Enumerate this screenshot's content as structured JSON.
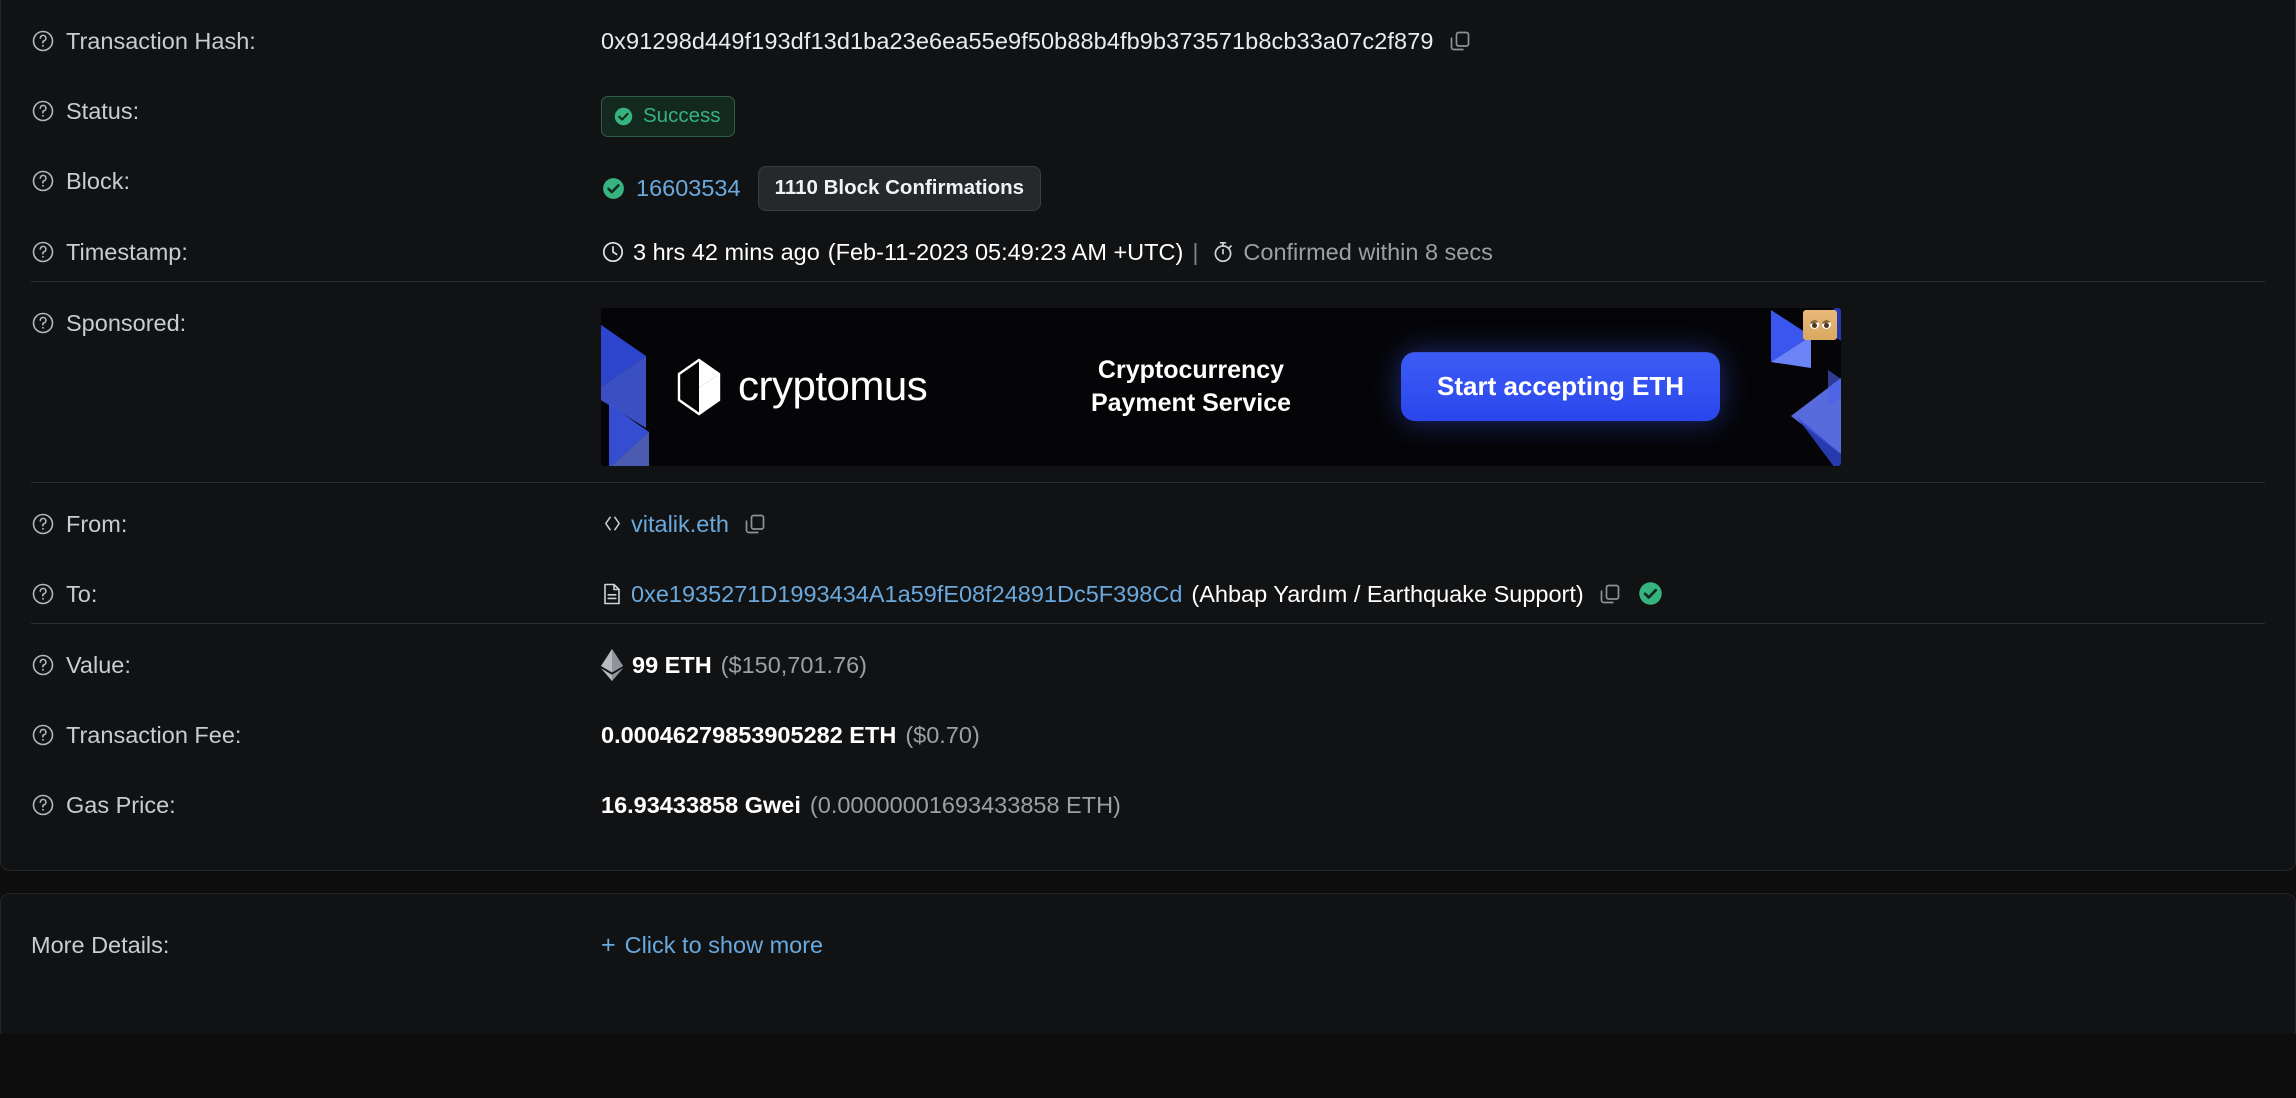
{
  "theme": {
    "page_bg": "#0d0d0d",
    "card_bg": "#111213",
    "divider": "#2a2c2f",
    "link_blue": "#6aa9dd",
    "success_green": "#36b37e",
    "text_primary": "#e9ecef",
    "text_muted": "#9aa0a6",
    "banner_cta_blue": "#3a58f5"
  },
  "rows": {
    "transaction_hash": {
      "label": "Transaction Hash:",
      "help_icon": "help-circle-icon",
      "value": "0x91298d449f193df13d1ba23e6ea55e9f50b88b4fb9b373571b8cb33a07c2f879",
      "copy_icon": "copy-icon"
    },
    "status": {
      "label": "Status:",
      "help_icon": "help-circle-icon",
      "badge_text": "Success",
      "badge_icon": "check-circle-icon"
    },
    "block": {
      "label": "Block:",
      "help_icon": "help-circle-icon",
      "check_icon": "check-circle-icon",
      "number": "16603534",
      "confirmations": "1110 Block Confirmations"
    },
    "timestamp": {
      "label": "Timestamp:",
      "help_icon": "help-circle-icon",
      "clock_icon": "clock-icon",
      "relative": "3 hrs 42 mins ago",
      "absolute": "(Feb-11-2023 05:49:23 AM +UTC)",
      "separator": "|",
      "stopwatch_icon": "stopwatch-icon",
      "confirmed_within": "Confirmed within 8 secs"
    },
    "sponsored": {
      "label": "Sponsored:",
      "help_icon": "help-circle-icon",
      "banner": {
        "brand": "cryptomus",
        "brand_icon": "cube-logo-icon",
        "tagline_line1": "Cryptocurrency",
        "tagline_line2": "Payment Service",
        "cta": "Start accepting ETH",
        "badge_icon": "eyes-badge-icon"
      }
    },
    "from": {
      "label": "From:",
      "help_icon": "help-circle-icon",
      "code_icon": "code-brackets-icon",
      "address": "vitalik.eth",
      "copy_icon": "copy-icon"
    },
    "to": {
      "label": "To:",
      "help_icon": "help-circle-icon",
      "file_icon": "file-contract-icon",
      "address": "0xe1935271D1993434A1a59fE08f24891Dc5F398Cd",
      "name_tag": "(Ahbap Yardım / Earthquake Support)",
      "copy_icon": "copy-icon",
      "verified_icon": "check-circle-icon"
    },
    "value": {
      "label": "Value:",
      "help_icon": "help-circle-icon",
      "eth_icon": "ethereum-diamond-icon",
      "amount": "99 ETH",
      "fiat": "($150,701.76)"
    },
    "transaction_fee": {
      "label": "Transaction Fee:",
      "help_icon": "help-circle-icon",
      "amount": "0.00046279853905282 ETH",
      "fiat": "($0.70)"
    },
    "gas_price": {
      "label": "Gas Price:",
      "help_icon": "help-circle-icon",
      "amount": "16.93433858 Gwei",
      "eth_equiv": "(0.00000001693433858 ETH)"
    },
    "more_details": {
      "label": "More Details:",
      "plus": "+",
      "toggle_text": "Click to show more"
    }
  }
}
